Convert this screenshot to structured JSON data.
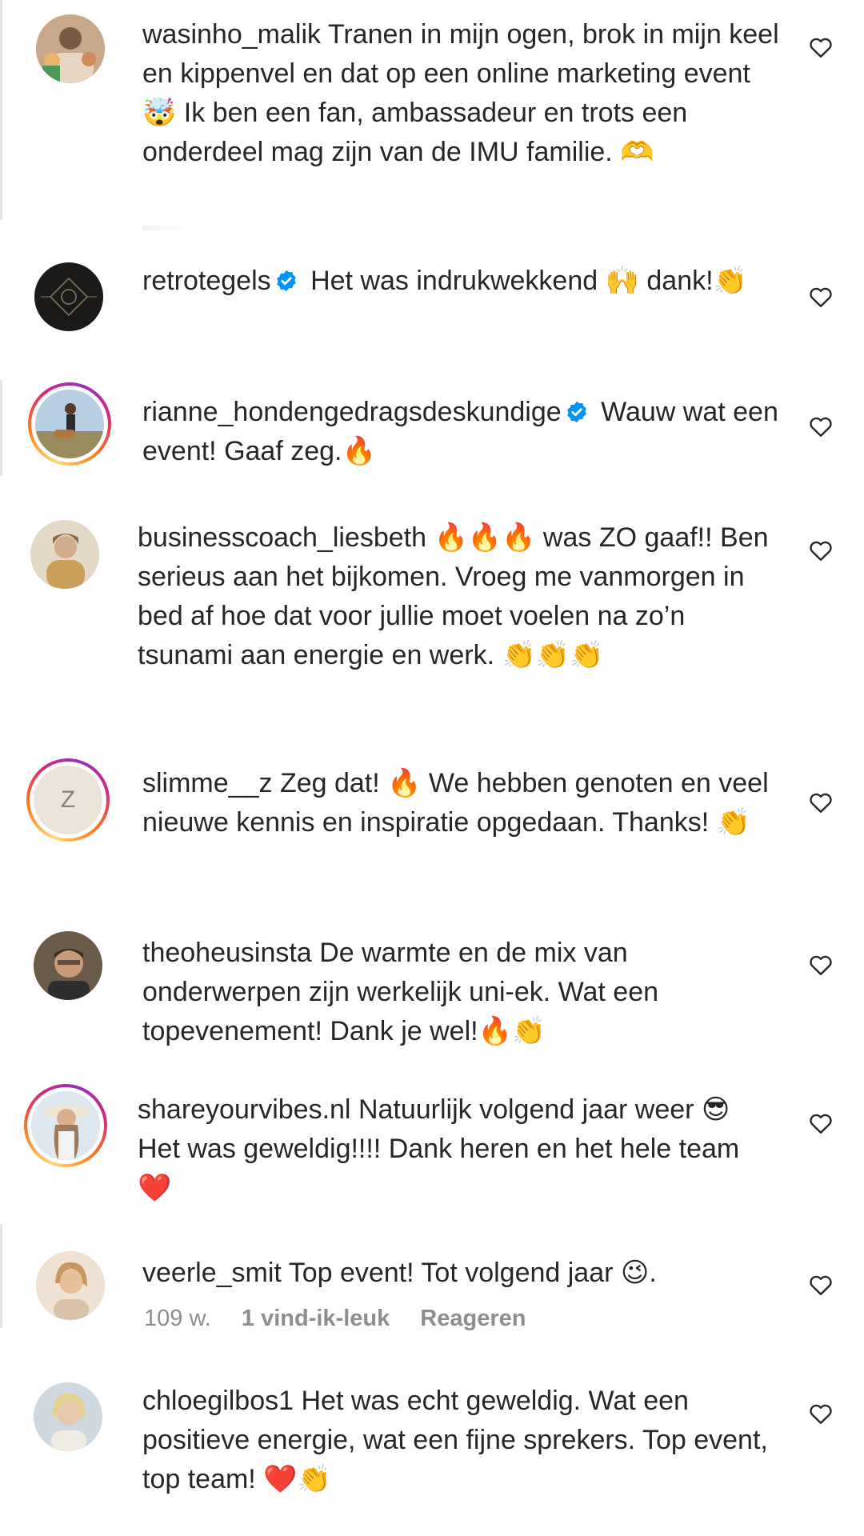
{
  "comments": [
    {
      "username": "wasinho_malik",
      "verified": false,
      "text": "Tranen in mijn ogen, brok in mijn keel en kippenvel en dat op een online marketing event 🤯 Ik ben een fan, ambassadeur en trots een onderdeel mag zijn van de IMU familie. 🫶",
      "avatar_icon": "person-group-avatar",
      "story_ring": false
    },
    {
      "username": "retrotegels",
      "verified": true,
      "text": "Het was indrukwekkend 🙌 dank!👏",
      "avatar_icon": "retrotegels-logo-avatar",
      "story_ring": false
    },
    {
      "username": "rianne_hondengedragsdeskundige",
      "verified": true,
      "text": "Wauw wat een event! Gaaf zeg.🔥",
      "avatar_icon": "person-with-dog-avatar",
      "story_ring": true
    },
    {
      "username": "businesscoach_liesbeth",
      "verified": false,
      "text": "🔥🔥🔥 was ZO gaaf!! Ben serieus aan het bijkomen. Vroeg me vanmorgen in bed af hoe dat voor jullie moet voelen na zo’n tsunami aan energie en werk. 👏👏👏",
      "avatar_icon": "woman-portrait-avatar",
      "story_ring": false
    },
    {
      "username": "slimme__z",
      "verified": false,
      "text": "Zeg dat! 🔥 We hebben genoten en veel nieuwe kennis en inspiratie opgedaan. Thanks! 👏",
      "avatar_icon": "letter-z-avatar",
      "avatar_letter": "Z",
      "story_ring": true
    },
    {
      "username": "theoheusinsta",
      "verified": false,
      "text": "De warmte en de mix van onderwerpen zijn werkelijk uni-ek. Wat een topevenement! Dank je wel!🔥👏",
      "avatar_icon": "man-portrait-avatar",
      "story_ring": false
    },
    {
      "username": "shareyourvibes.nl",
      "verified": false,
      "text": "Natuurlijk volgend jaar weer 😎 Het was geweldig!!!! Dank heren en het hele team ❤️",
      "avatar_icon": "woman-hat-avatar",
      "story_ring": true
    },
    {
      "username": "veerle_smit",
      "verified": false,
      "text": "Top event! Tot volgend jaar 😉.",
      "avatar_icon": "woman-portrait-avatar",
      "story_ring": false,
      "meta": {
        "age": "109 w.",
        "likes": "1 vind-ik-leuk",
        "reply": "Reageren"
      }
    },
    {
      "username": "chloegilbos1",
      "verified": false,
      "text": "Het was echt geweldig. Wat een positieve energie, wat een fijne sprekers. Top event, top team! ❤️👏",
      "avatar_icon": "woman-portrait-avatar",
      "story_ring": false
    }
  ],
  "colors": {
    "text": "#262626",
    "meta": "#8e8e8e",
    "verified": "#0095f6"
  }
}
